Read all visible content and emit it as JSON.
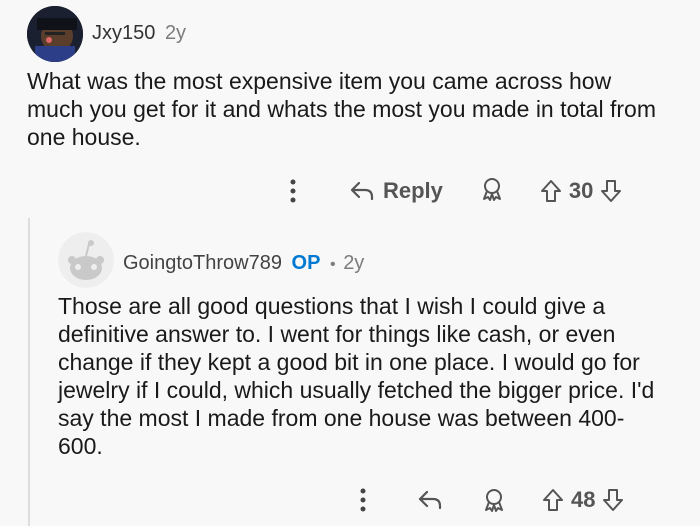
{
  "comments": [
    {
      "username": "Jxy150",
      "age": "2y",
      "body": "What was the most expensive item you came across how much you get for it and whats the most you made in total from one house.",
      "reply_label": "Reply",
      "score": "30"
    },
    {
      "username": "GoingtoThrow789",
      "op_badge": "OP",
      "separator": "•",
      "age": "2y",
      "body": "Those are all good questions that I wish I could give a definitive answer to. I went for things like cash, or even change if they kept a good bit in one place. I would go for jewelry if I could, which usually fetched the bigger price. I'd say the most I made from one house was between 400-600.",
      "score": "48"
    }
  ],
  "icons": {
    "more": "more-vertical-icon",
    "reply": "reply-arrow-icon",
    "award": "award-icon",
    "upvote": "upvote-arrow-icon",
    "downvote": "downvote-arrow-icon"
  }
}
